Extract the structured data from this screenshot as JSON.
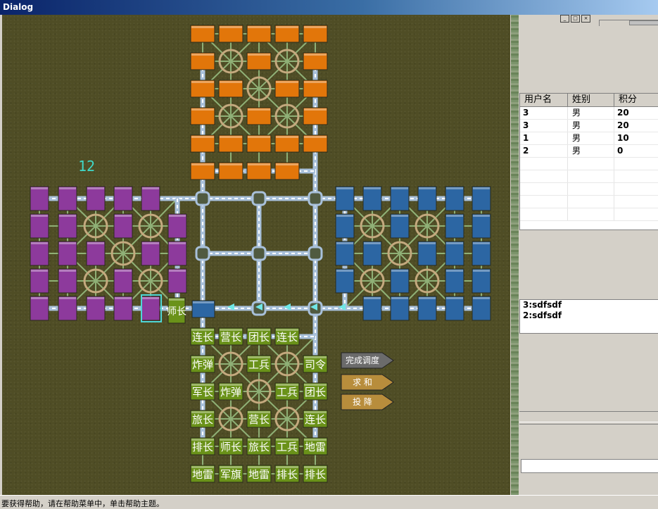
{
  "window": {
    "title": "Dialog"
  },
  "board": {
    "timer": "12",
    "piece_colors": {
      "orange": "#e2760a",
      "purple": "#8d3a9c",
      "blue": "#2c66a3",
      "green": "#6a9219",
      "path": "#a8c0da",
      "camp": "#c4a97e"
    },
    "south_pieces": [
      [
        "连长",
        "营长",
        "团长",
        "连长"
      ],
      [
        "炸弹",
        "工兵",
        "司令"
      ],
      [
        "军长",
        "炸弹",
        "工兵",
        "团长"
      ],
      [
        "旅长",
        "营长",
        "连长"
      ],
      [
        "排长",
        "师长",
        "旅长",
        "工兵",
        "地雷"
      ],
      [
        "地雷",
        "军旗",
        "地雷",
        "排长",
        "排长"
      ]
    ],
    "center_piece": "师长",
    "buttons": {
      "done": "完成调度",
      "draw": "求 和",
      "surrender": "投 降"
    }
  },
  "user_table": {
    "headers": [
      "用户名",
      "姓别",
      "积分"
    ],
    "rows": [
      [
        "3",
        "男",
        "20"
      ],
      [
        "3",
        "男",
        "20"
      ],
      [
        "1",
        "男",
        "10"
      ],
      [
        "2",
        "男",
        "0"
      ]
    ]
  },
  "chat": {
    "lines": [
      "3:sdfsdf",
      "2:sdfsdf"
    ]
  },
  "status": {
    "text": "要获得帮助，请在帮助菜单中，单击帮助主题。"
  }
}
